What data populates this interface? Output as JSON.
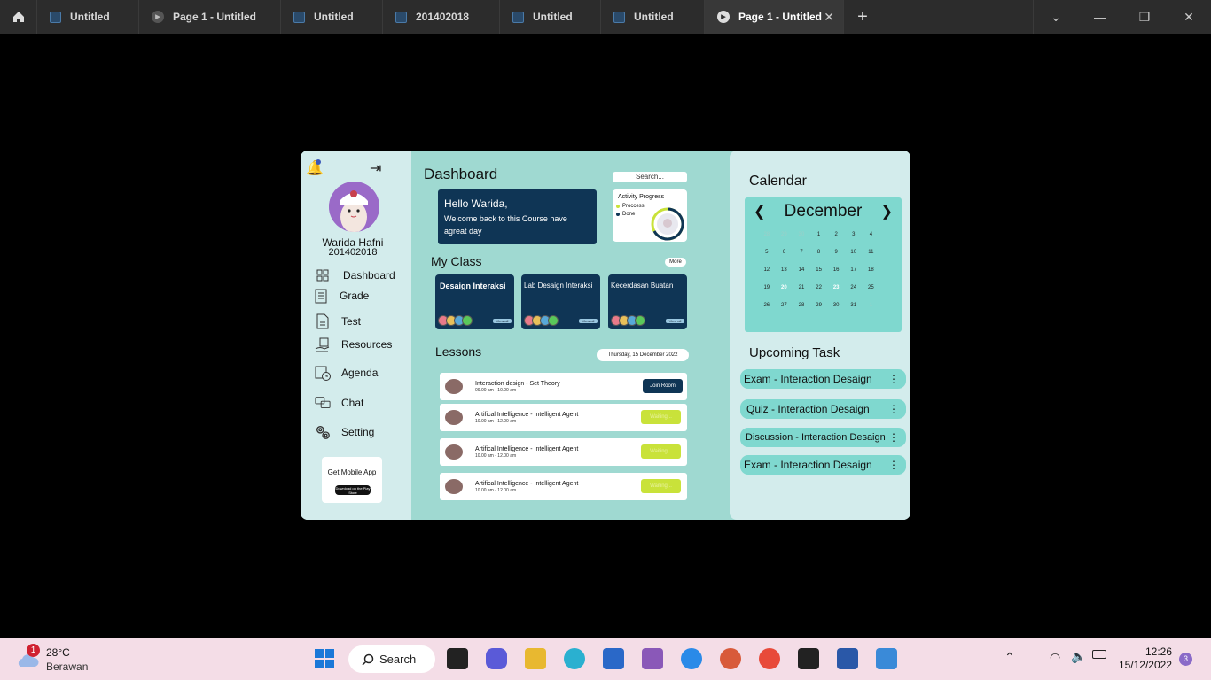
{
  "titlebar": {
    "tabs": [
      {
        "label": "Untitled",
        "icon": "figma-file-icon"
      },
      {
        "label": "Page 1 - Untitled",
        "icon": "prototype-play-icon"
      },
      {
        "label": "Untitled",
        "icon": "figma-file-icon"
      },
      {
        "label": "201402018",
        "icon": "figma-file-icon"
      },
      {
        "label": "Untitled",
        "icon": "figma-file-icon"
      },
      {
        "label": "Untitled",
        "icon": "figma-file-icon"
      },
      {
        "label": "Page 1 - Untitled",
        "icon": "prototype-play-icon",
        "active": true
      }
    ],
    "close_glyph": "✕",
    "plus_glyph": "+"
  },
  "sidebar": {
    "name": "Warida Hafni",
    "id": "201402018",
    "nav": [
      {
        "label": "Dashboard",
        "icon": "grid-icon"
      },
      {
        "label": "Grade",
        "icon": "grade-sheet-icon"
      },
      {
        "label": "Test",
        "icon": "document-icon"
      },
      {
        "label": "Resources",
        "icon": "resources-hand-icon"
      },
      {
        "label": "Agenda",
        "icon": "agenda-clock-icon"
      },
      {
        "label": "Chat",
        "icon": "chat-bubbles-icon"
      },
      {
        "label": "Setting",
        "icon": "gears-icon"
      }
    ],
    "mobile": {
      "title": "Get Mobile App",
      "badge": "Download on the Play Store"
    }
  },
  "main": {
    "title": "Dashboard",
    "search_placeholder": "Search...",
    "greeting": {
      "title": "Hello Warida,",
      "message": "Welcome back  to this Course have agreat day"
    },
    "activity": {
      "title": "Activity Progress",
      "legend": [
        {
          "label": "Proccess",
          "color": "#c9e23a"
        },
        {
          "label": "Done",
          "color": "#0f3555"
        }
      ]
    },
    "my_class": {
      "title": "My Class",
      "more": "More",
      "view_all": "View all",
      "cards": [
        "Desaign Interaksi",
        "Lab Desaign Interaksi",
        "Kecerdasan Buatan"
      ]
    },
    "lessons": {
      "title": "Lessons",
      "date": "Thursday, 15 December 2022",
      "items": [
        {
          "title": "Interaction design - Set Theory",
          "time": "09.00 am - 10.00 am",
          "button": "Join Room",
          "kind": "join"
        },
        {
          "title": "Artifical Intelligence - Intelligent Agent",
          "time": "10.00 am - 12.00 am",
          "button": "Waiting...",
          "kind": "wait"
        },
        {
          "title": "Artifical Intelligence - Intelligent Agent",
          "time": "10.00 am - 12.00 am",
          "button": "Waiting...",
          "kind": "wait"
        },
        {
          "title": "Artifical Intelligence - Intelligent Agent",
          "time": "10.00 am - 12.00 am",
          "button": "Waiting...",
          "kind": "wait"
        }
      ]
    }
  },
  "calendar": {
    "title": "Calendar",
    "month": "December",
    "days": [
      {
        "d": "28",
        "dim": true
      },
      {
        "d": "29",
        "dim": true
      },
      {
        "d": "30",
        "dim": true
      },
      {
        "d": "1"
      },
      {
        "d": "2"
      },
      {
        "d": "3"
      },
      {
        "d": "4"
      },
      {
        "d": "5"
      },
      {
        "d": "6"
      },
      {
        "d": "7"
      },
      {
        "d": "8"
      },
      {
        "d": "9"
      },
      {
        "d": "10"
      },
      {
        "d": "11"
      },
      {
        "d": "12"
      },
      {
        "d": "13"
      },
      {
        "d": "14"
      },
      {
        "d": "15"
      },
      {
        "d": "16"
      },
      {
        "d": "17"
      },
      {
        "d": "18"
      },
      {
        "d": "19"
      },
      {
        "d": "20",
        "hl": true
      },
      {
        "d": "21"
      },
      {
        "d": "22"
      },
      {
        "d": "23",
        "hl": true
      },
      {
        "d": "24"
      },
      {
        "d": "25"
      },
      {
        "d": "26"
      },
      {
        "d": "27"
      },
      {
        "d": "28"
      },
      {
        "d": "29"
      },
      {
        "d": "30"
      },
      {
        "d": "31"
      },
      {
        "d": "1",
        "dim": true
      }
    ]
  },
  "upcoming": {
    "title": "Upcoming Task",
    "items": [
      "Exam - Interaction Desaign",
      "Quiz - Interaction Desaign",
      "Discussion - Interaction Desaign",
      "Exam - Interaction Desaign"
    ]
  },
  "taskbar": {
    "weather": {
      "temp": "28°C",
      "desc": "Berawan",
      "badge": "1"
    },
    "search": "Search",
    "time": "12:26",
    "date": "15/12/2022",
    "notif_count": "3"
  }
}
